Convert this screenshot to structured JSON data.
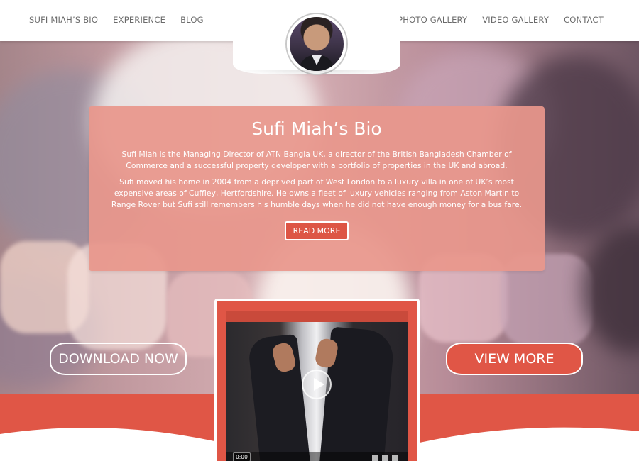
{
  "nav": {
    "left": [
      "SUFI MIAH’S BIO",
      "EXPERIENCE",
      "BLOG"
    ],
    "right": [
      "PHOTO GALLERY",
      "VIDEO GALLERY",
      "CONTACT"
    ]
  },
  "bio": {
    "title": "Sufi Miah’s Bio",
    "paragraph1": "Sufi Miah is the Managing Director of ATN Bangla UK, a director of the British Bangladesh Chamber of Commerce and a successful property developer with a portfolio of properties in the UK and abroad.",
    "paragraph2": "Sufi moved his home in 2004 from a deprived part of West London to a luxury villa in one of UK’s most expensive areas of Cuffley, Hertfordshire. He owns a fleet of luxury vehicles ranging from Aston Martin to Range Rover but Sufi still remembers his humble days when he did not have enough money for a bus fare.",
    "read_more": "READ MORE"
  },
  "buttons": {
    "download": "DOWNLOAD NOW",
    "view_more": "VIEW MORE"
  },
  "video": {
    "time": "0:00"
  },
  "colors": {
    "accent": "#e05646",
    "card": "#e8978c"
  }
}
